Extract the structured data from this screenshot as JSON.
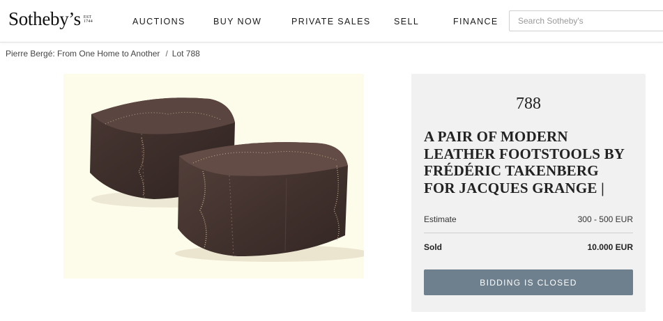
{
  "header": {
    "logo_text": "Sotheby’s",
    "logo_est": [
      "EST",
      "1744"
    ],
    "nav": [
      {
        "label": "AUCTIONS"
      },
      {
        "label": "BUY NOW"
      },
      {
        "label": "PRIVATE SALES"
      },
      {
        "label": "SELL"
      },
      {
        "label": "FINANCE"
      }
    ],
    "search_placeholder": "Search Sotheby's"
  },
  "breadcrumb": {
    "sale": "Pierre Bergé: From One Home to Another",
    "separator": "/",
    "lot": "Lot 788"
  },
  "lot": {
    "number": "788",
    "title": "A PAIR OF MODERN LEATHER FOOTSTOOLS BY FRÉDÉRIC TAKENBERG FOR JACQUES GRANGE |",
    "estimate_label": "Estimate",
    "estimate_value": "300 - 500 EUR",
    "sold_label": "Sold",
    "sold_value": "10.000 EUR",
    "status_button": "BIDDING IS CLOSED"
  },
  "colors": {
    "button_bg": "#6e7f8d",
    "panel_bg": "#f1f1f1",
    "image_bg": "#fdfbea",
    "leather": "#3e2e2a"
  },
  "image": {
    "icon": "lot-photo-leather-footstools"
  }
}
